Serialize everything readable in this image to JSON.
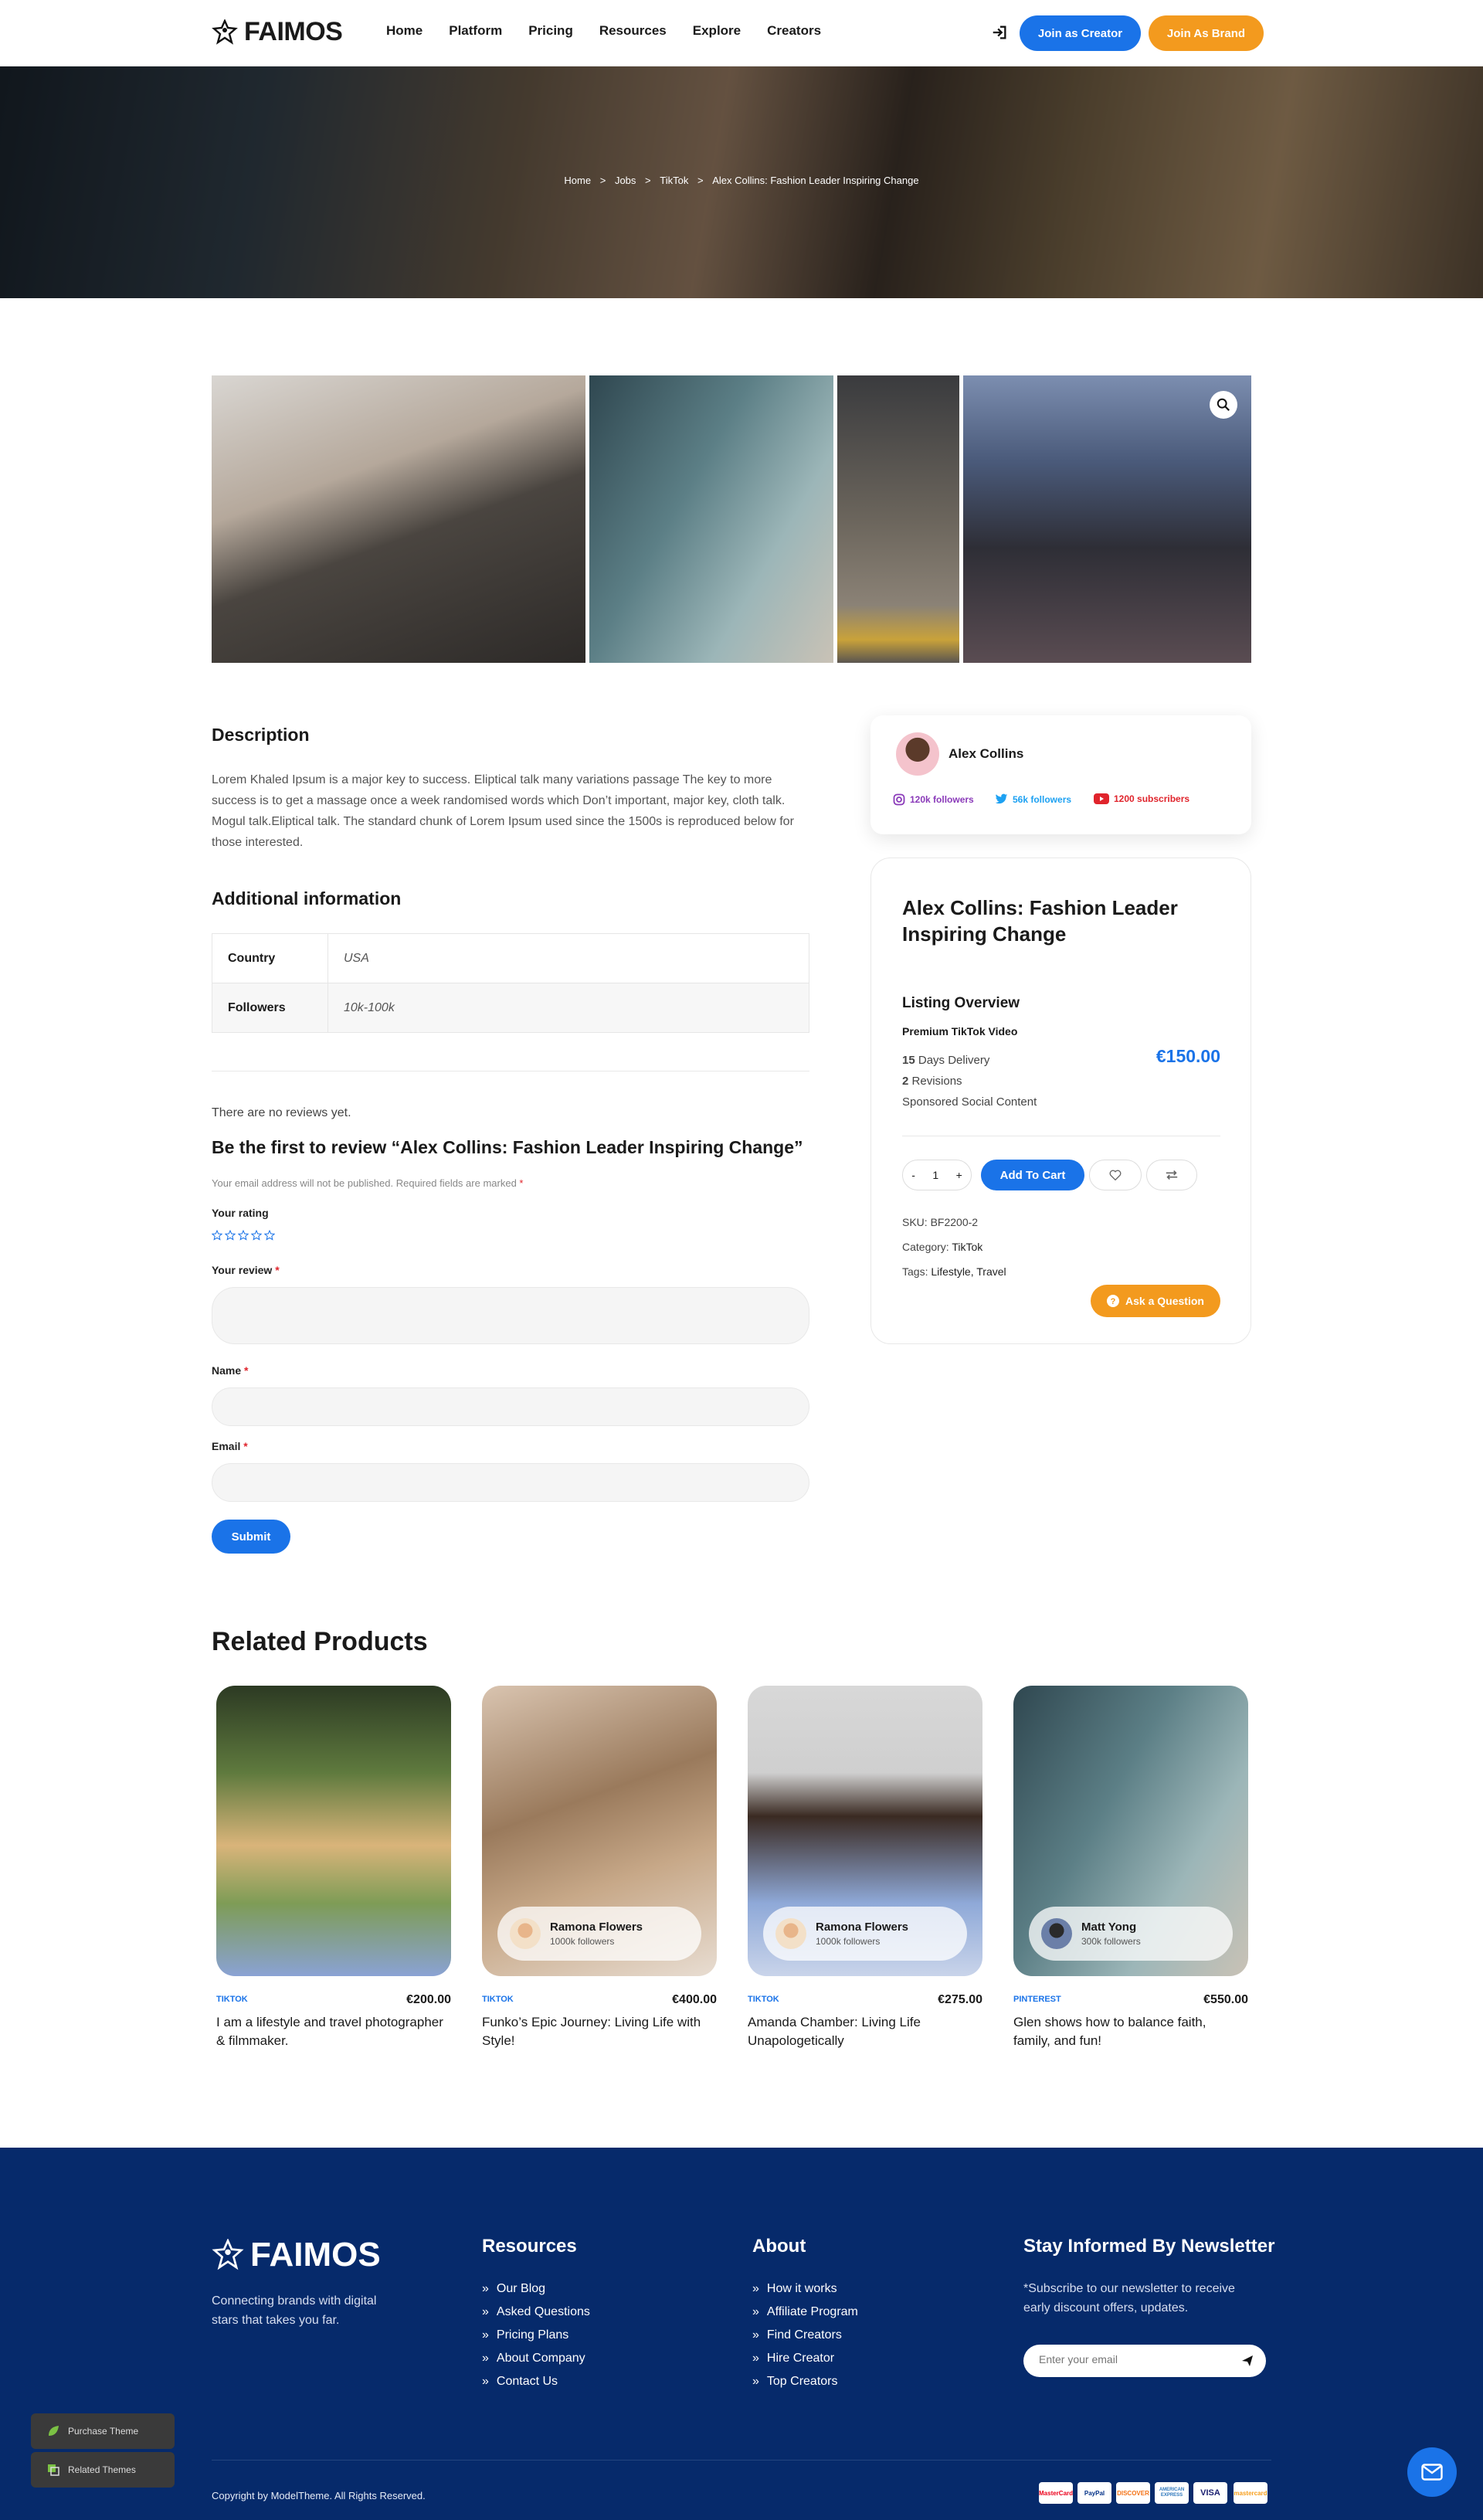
{
  "header": {
    "logo_text": "FAIMOS",
    "nav": [
      "Home",
      "Platform",
      "Pricing",
      "Resources",
      "Explore",
      "Creators"
    ],
    "join_creator": "Join as Creator",
    "join_brand": "Join As Brand"
  },
  "breadcrumb": {
    "items": [
      "Home",
      ">",
      "Jobs",
      ">",
      "TikTok",
      ">",
      "Alex Collins: Fashion Leader Inspiring Change"
    ]
  },
  "description": {
    "heading": "Description",
    "text": "Lorem Khaled Ipsum is a major key to success. Eliptical talk many variations passage The key to more success is to get a massage once a week randomised words which Don’t important, major key, cloth talk. Mogul talk.Eliptical talk. The standard chunk of Lorem Ipsum used since the 1500s is reproduced below for those interested."
  },
  "additional": {
    "heading": "Additional information",
    "rows": [
      {
        "key": "Country",
        "value": "USA"
      },
      {
        "key": "Followers",
        "value": "10k-100k"
      }
    ]
  },
  "reviews": {
    "none": "There are no reviews yet.",
    "heading": "Be the first to review “Alex Collins: Fashion Leader Inspiring Change”",
    "note": "Your email address will not be published. Required fields are marked",
    "rating_label": "Your rating",
    "review_label": "Your review",
    "name_label": "Name",
    "email_label": "Email",
    "required_mark": "*",
    "submit": "Submit"
  },
  "creator": {
    "name": "Alex Collins",
    "instagram": "120k followers",
    "twitter": "56k followers",
    "youtube": "1200 subscribers"
  },
  "listing": {
    "title": "Alex Collins: Fashion Leader Inspiring Change",
    "overview": "Listing Overview",
    "package": "Premium TikTok Video",
    "price": "€150.00",
    "delivery_num": "15",
    "delivery_text": "Days Delivery",
    "revisions_num": "2",
    "revisions_text": "Revisions",
    "content": "Sponsored Social Content",
    "qty_minus": "-",
    "qty": "1",
    "qty_plus": "+",
    "add_to_cart": "Add To Cart",
    "sku_label": "SKU:",
    "sku": "BF2200-2",
    "category_label": "Category:",
    "category": "TikTok",
    "tags_label": "Tags:",
    "tags": "Lifestyle, Travel",
    "ask": "Ask a Question"
  },
  "related": {
    "heading": "Related Products",
    "items": [
      {
        "tag": "TIKTOK",
        "price": "€200.00",
        "title": "I am a lifestyle and travel photographer & filmmaker.",
        "creator": "",
        "followers": ""
      },
      {
        "tag": "TIKTOK",
        "price": "€400.00",
        "title": "Funko’s Epic Journey: Living Life with Style!",
        "creator": "Ramona Flowers",
        "followers": "1000k followers"
      },
      {
        "tag": "TIKTOK",
        "price": "€275.00",
        "title": "Amanda Chamber: Living Life Unapologetically",
        "creator": "Ramona Flowers",
        "followers": "1000k followers"
      },
      {
        "tag": "PINTEREST",
        "price": "€550.00",
        "title": "Glen shows how to balance faith, family, and fun!",
        "creator": "Matt Yong",
        "followers": "300k followers"
      }
    ]
  },
  "footer": {
    "logo_text": "FAIMOS",
    "tagline": "Connecting brands with digital stars that takes you far.",
    "resources_heading": "Resources",
    "resources": [
      "Our Blog",
      "Asked Questions",
      "Pricing Plans",
      "About Company",
      "Contact Us"
    ],
    "about_heading": "About",
    "about": [
      "How it works",
      "Affiliate Program",
      "Find Creators",
      "Hire Creator",
      "Top Creators"
    ],
    "newsletter_heading": "Stay Informed By Newsletter",
    "newsletter_text": "*Subscribe to our newsletter to receive early discount offers, updates.",
    "email_placeholder": "Enter your email",
    "copyright": "Copyright by ModelTheme. All Rights Reserved.",
    "payments": [
      "MasterCard",
      "PayPal",
      "DISCOVER",
      "AMERICAN EXPRESS",
      "VISA",
      "mastercard"
    ]
  },
  "floating": {
    "purchase": "Purchase Theme",
    "related_themes": "Related Themes"
  },
  "colors": {
    "primary_blue": "#1a73e8",
    "orange": "#f39a1e",
    "footer_bg": "#062a6b"
  }
}
